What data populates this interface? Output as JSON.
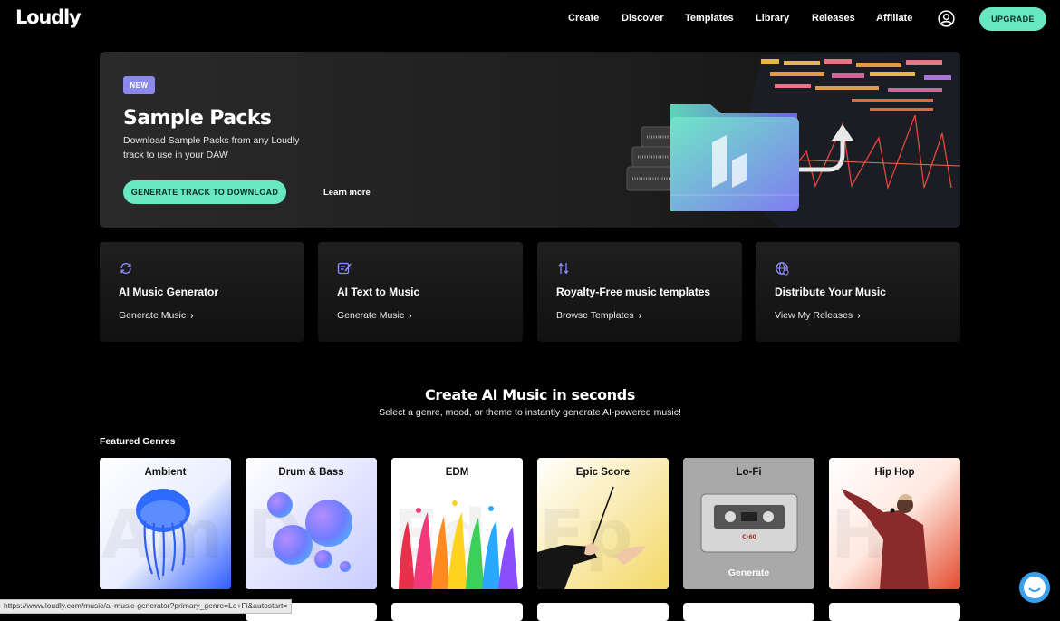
{
  "header": {
    "logo": "Loudly",
    "nav": [
      "Create",
      "Discover",
      "Templates",
      "Library",
      "Releases",
      "Affiliate"
    ],
    "upgrade_label": "UPGRADE"
  },
  "hero": {
    "badge": "NEW",
    "title": "Sample Packs",
    "subtitle": "Download Sample Packs from any Loudly track to use in your DAW",
    "cta_label": "GENERATE TRACK TO DOWNLOAD",
    "learn_more": "Learn more"
  },
  "cards": [
    {
      "title": "AI Music Generator",
      "link": "Generate Music",
      "icon": "refresh-icon"
    },
    {
      "title": "AI Text to Music",
      "link": "Generate Music",
      "icon": "text-edit-icon"
    },
    {
      "title": "Royalty-Free music templates",
      "link": "Browse Templates",
      "icon": "sliders-icon"
    },
    {
      "title": "Distribute Your Music",
      "link": "View My Releases",
      "icon": "globe-icon"
    }
  ],
  "section": {
    "title": "Create AI Music in seconds",
    "subtitle": "Select a genre, mood, or theme to instantly generate AI-powered music!",
    "featured_label": "Featured Genres"
  },
  "genres": [
    {
      "label": "Ambient"
    },
    {
      "label": "Drum & Bass"
    },
    {
      "label": "EDM"
    },
    {
      "label": "Epic Score"
    },
    {
      "label": "Lo-Fi",
      "hover_action": "Generate"
    },
    {
      "label": "Hip Hop"
    }
  ],
  "status_bar": {
    "url": "https://www.loudly.com/music/ai-music-generator?primary_genre=Lo+Fi&autostart="
  },
  "colors": {
    "accent": "#68e8c1",
    "badge": "#8b88ee",
    "icon": "#8e8bff",
    "background": "#000000"
  }
}
